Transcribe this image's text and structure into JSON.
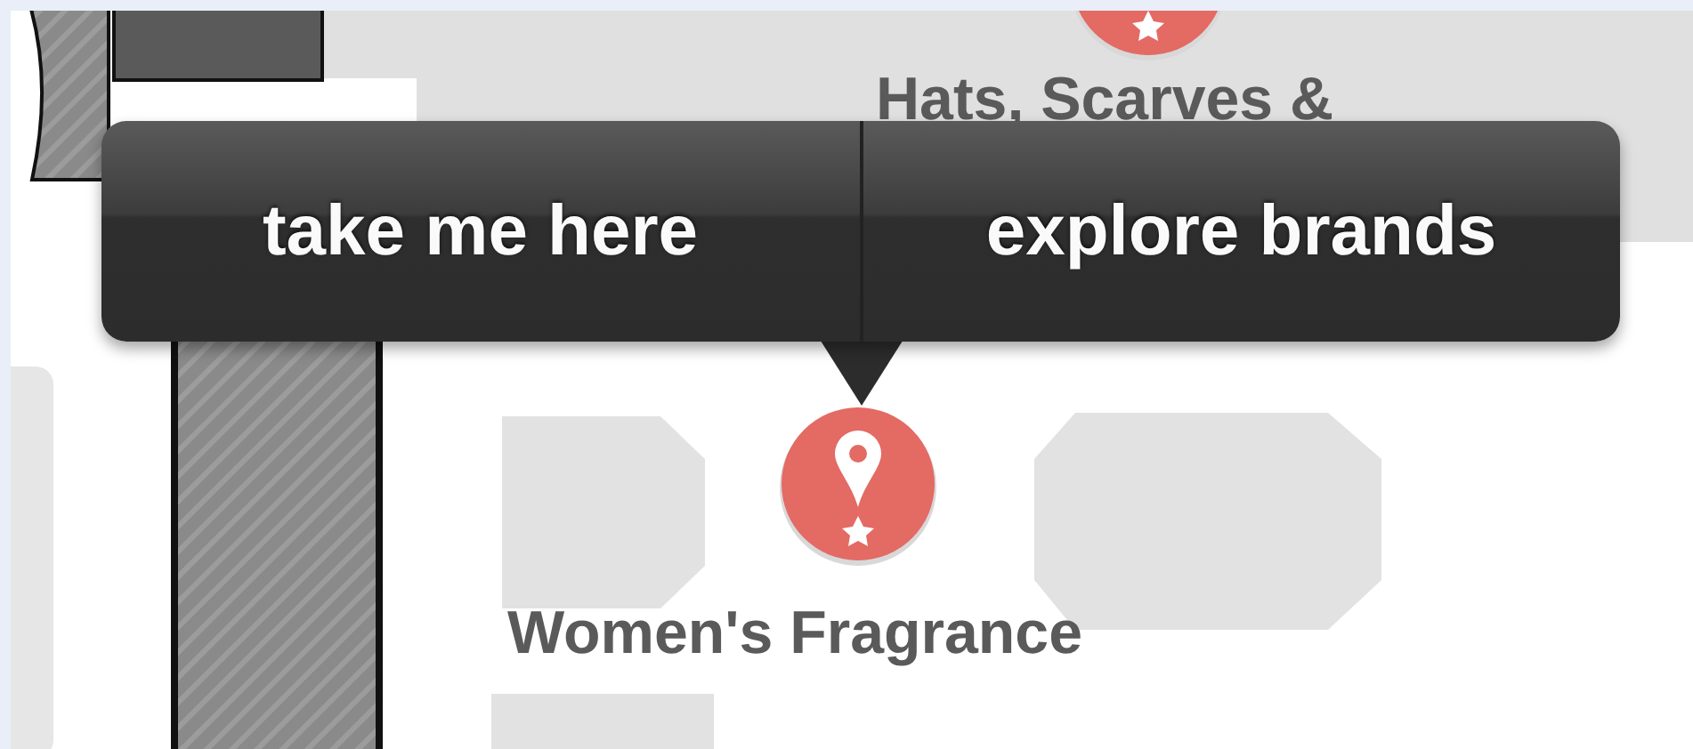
{
  "map": {
    "stores": [
      {
        "name": "Hats, Scarves &",
        "kind": "partial"
      },
      {
        "name": "Women's Fragrance",
        "kind": "selected"
      }
    ]
  },
  "popup": {
    "actions": [
      {
        "label": "take me here"
      },
      {
        "label": "explore brands"
      }
    ]
  }
}
